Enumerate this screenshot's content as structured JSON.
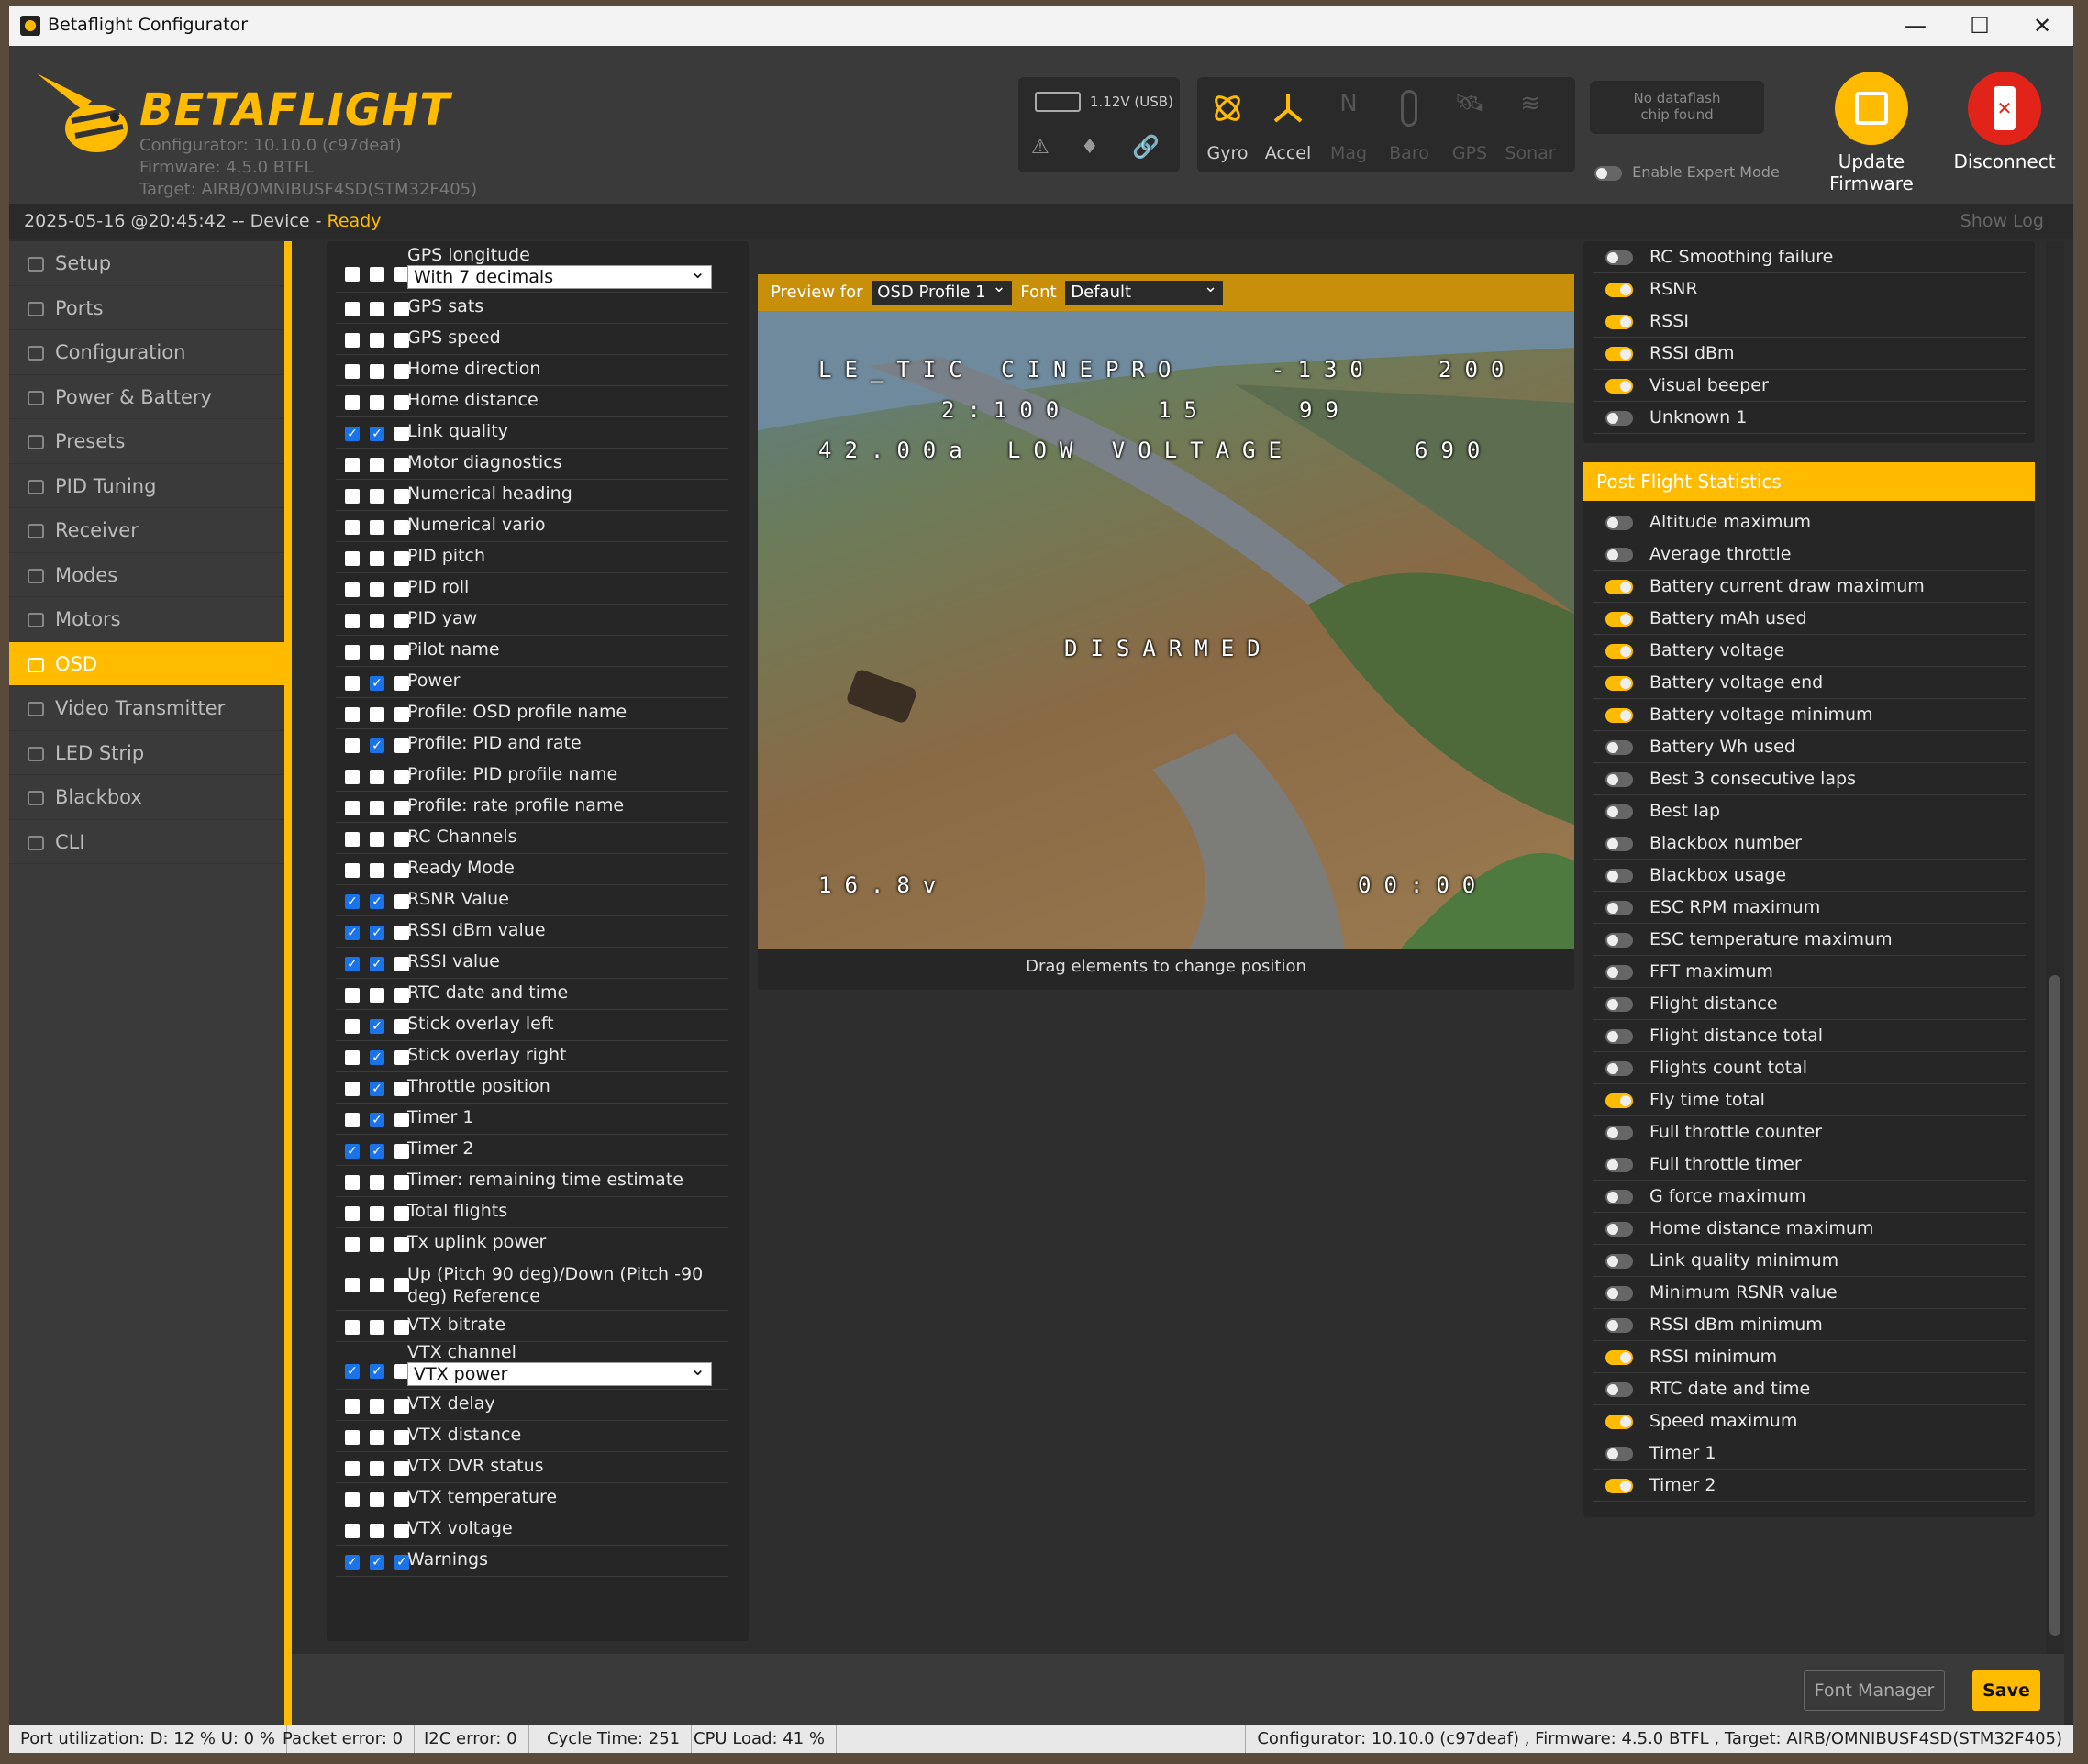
{
  "window": {
    "title": "Betaflight Configurator",
    "minimize": "—",
    "maximize": "☐",
    "close": "✕"
  },
  "header": {
    "brand": "BETAFLIGHT",
    "configurator": "Configurator: 10.10.0 (c97deaf)",
    "firmware": "Firmware: 4.5.0 BTFL",
    "target": "Target: AIRB/OMNIBUSF4SD(STM32F405)",
    "battery": "1.12V (USB)",
    "sensors": [
      "Gyro",
      "Accel",
      "Mag",
      "Baro",
      "GPS",
      "Sonar"
    ],
    "dataflash": [
      "No dataflash",
      "chip found"
    ],
    "expert_mode": "Enable Expert Mode",
    "update_firmware": [
      "Update",
      "Firmware"
    ],
    "disconnect": "Disconnect"
  },
  "status": {
    "datetime": "2025-05-16 @20:45:42",
    "sep": " -- Device - ",
    "state": "Ready",
    "show_log": "Show Log"
  },
  "sidebar": {
    "items": [
      "Setup",
      "Ports",
      "Configuration",
      "Power & Battery",
      "Presets",
      "PID Tuning",
      "Receiver",
      "Modes",
      "Motors",
      "OSD",
      "Video Transmitter",
      "LED Strip",
      "Blackbox",
      "CLI"
    ],
    "active": "OSD"
  },
  "elements": [
    {
      "label": "GPS longitude",
      "c": [
        0,
        0,
        0
      ],
      "select": "With 7 decimals"
    },
    {
      "label": "GPS sats",
      "c": [
        0,
        0,
        0
      ]
    },
    {
      "label": "GPS speed",
      "c": [
        0,
        0,
        0
      ]
    },
    {
      "label": "Home direction",
      "c": [
        0,
        0,
        0
      ]
    },
    {
      "label": "Home distance",
      "c": [
        0,
        0,
        0
      ]
    },
    {
      "label": "Link quality",
      "c": [
        1,
        1,
        0
      ]
    },
    {
      "label": "Motor diagnostics",
      "c": [
        0,
        0,
        0
      ]
    },
    {
      "label": "Numerical heading",
      "c": [
        0,
        0,
        0
      ]
    },
    {
      "label": "Numerical vario",
      "c": [
        0,
        0,
        0
      ]
    },
    {
      "label": "PID pitch",
      "c": [
        0,
        0,
        0
      ]
    },
    {
      "label": "PID roll",
      "c": [
        0,
        0,
        0
      ]
    },
    {
      "label": "PID yaw",
      "c": [
        0,
        0,
        0
      ]
    },
    {
      "label": "Pilot name",
      "c": [
        0,
        0,
        0
      ]
    },
    {
      "label": "Power",
      "c": [
        0,
        1,
        0
      ]
    },
    {
      "label": "Profile: OSD profile name",
      "c": [
        0,
        0,
        0
      ]
    },
    {
      "label": "Profile: PID and rate",
      "c": [
        0,
        1,
        0
      ]
    },
    {
      "label": "Profile: PID profile name",
      "c": [
        0,
        0,
        0
      ]
    },
    {
      "label": "Profile: rate profile name",
      "c": [
        0,
        0,
        0
      ]
    },
    {
      "label": "RC Channels",
      "c": [
        0,
        0,
        0
      ]
    },
    {
      "label": "Ready Mode",
      "c": [
        0,
        0,
        0
      ]
    },
    {
      "label": "RSNR Value",
      "c": [
        1,
        1,
        0
      ]
    },
    {
      "label": "RSSI dBm value",
      "c": [
        1,
        1,
        0
      ]
    },
    {
      "label": "RSSI value",
      "c": [
        1,
        1,
        0
      ]
    },
    {
      "label": "RTC date and time",
      "c": [
        0,
        0,
        0
      ]
    },
    {
      "label": "Stick overlay left",
      "c": [
        0,
        1,
        0
      ]
    },
    {
      "label": "Stick overlay right",
      "c": [
        0,
        1,
        0
      ]
    },
    {
      "label": "Throttle position",
      "c": [
        0,
        1,
        0
      ]
    },
    {
      "label": "Timer 1",
      "c": [
        0,
        1,
        0
      ]
    },
    {
      "label": "Timer 2",
      "c": [
        1,
        1,
        0
      ]
    },
    {
      "label": "Timer: remaining time estimate",
      "c": [
        0,
        0,
        0
      ]
    },
    {
      "label": "Total flights",
      "c": [
        0,
        0,
        0
      ]
    },
    {
      "label": "Tx uplink power",
      "c": [
        0,
        0,
        0
      ]
    },
    {
      "label": "Up (Pitch 90 deg)/Down (Pitch -90 deg) Reference",
      "c": [
        0,
        0,
        0
      ],
      "tall": true
    },
    {
      "label": "VTX bitrate",
      "c": [
        0,
        0,
        0
      ]
    },
    {
      "label": "VTX channel",
      "c": [
        1,
        1,
        0
      ],
      "select": "VTX power"
    },
    {
      "label": "VTX delay",
      "c": [
        0,
        0,
        0
      ]
    },
    {
      "label": "VTX distance",
      "c": [
        0,
        0,
        0
      ]
    },
    {
      "label": "VTX DVR status",
      "c": [
        0,
        0,
        0
      ]
    },
    {
      "label": "VTX temperature",
      "c": [
        0,
        0,
        0
      ]
    },
    {
      "label": "VTX voltage",
      "c": [
        0,
        0,
        0
      ]
    },
    {
      "label": "Warnings",
      "c": [
        1,
        1,
        1
      ]
    }
  ],
  "preview": {
    "preview_for": "Preview for",
    "profile": "OSD Profile 1",
    "font_label": "Font",
    "font": "Default",
    "caption": "Drag elements to change position",
    "osd": {
      "craft": "LE_TIC CINEPRO",
      "rssi_dbm": "-130",
      "rsnr_val": "200",
      "profile": "2:100",
      "rsnr": "15",
      "lq": "99",
      "current": "42.00a",
      "warning": "LOW VOLTAGE",
      "mah": "690",
      "disarmed": "DISARMED",
      "voltage": "16.8v",
      "timer": "00:00"
    }
  },
  "warnings_list": [
    {
      "label": "RC Smoothing failure",
      "on": false
    },
    {
      "label": "RSNR",
      "on": true
    },
    {
      "label": "RSSI",
      "on": true
    },
    {
      "label": "RSSI dBm",
      "on": true
    },
    {
      "label": "Visual beeper",
      "on": true
    },
    {
      "label": "Unknown 1",
      "on": false
    }
  ],
  "post_flight": {
    "title": "Post Flight Statistics",
    "items": [
      {
        "label": "Altitude maximum",
        "on": false
      },
      {
        "label": "Average throttle",
        "on": false
      },
      {
        "label": "Battery current draw maximum",
        "on": true
      },
      {
        "label": "Battery mAh used",
        "on": true
      },
      {
        "label": "Battery voltage",
        "on": true
      },
      {
        "label": "Battery voltage end",
        "on": true
      },
      {
        "label": "Battery voltage minimum",
        "on": true
      },
      {
        "label": "Battery Wh used",
        "on": false
      },
      {
        "label": "Best 3 consecutive laps",
        "on": false
      },
      {
        "label": "Best lap",
        "on": false
      },
      {
        "label": "Blackbox number",
        "on": false
      },
      {
        "label": "Blackbox usage",
        "on": false
      },
      {
        "label": "ESC RPM maximum",
        "on": false
      },
      {
        "label": "ESC temperature maximum",
        "on": false
      },
      {
        "label": "FFT maximum",
        "on": false
      },
      {
        "label": "Flight distance",
        "on": false
      },
      {
        "label": "Flight distance total",
        "on": false
      },
      {
        "label": "Flights count total",
        "on": false
      },
      {
        "label": "Fly time total",
        "on": true
      },
      {
        "label": "Full throttle counter",
        "on": false
      },
      {
        "label": "Full throttle timer",
        "on": false
      },
      {
        "label": "G force maximum",
        "on": false
      },
      {
        "label": "Home distance maximum",
        "on": false
      },
      {
        "label": "Link quality minimum",
        "on": false
      },
      {
        "label": "Minimum RSNR value",
        "on": false
      },
      {
        "label": "RSSI dBm minimum",
        "on": false
      },
      {
        "label": "RSSI minimum",
        "on": true
      },
      {
        "label": "RTC date and time",
        "on": false
      },
      {
        "label": "Speed maximum",
        "on": true
      },
      {
        "label": "Timer 1",
        "on": false
      },
      {
        "label": "Timer 2",
        "on": true
      }
    ]
  },
  "footer": {
    "font_manager": "Font Manager",
    "save": "Save"
  },
  "bottom": {
    "port": "Port utilization: D: 12 % U: 0 %",
    "packet": "Packet error: 0",
    "i2c": "I2C error: 0",
    "cycle": "Cycle Time: 251",
    "cpu": "CPU Load: 41 %",
    "version": "Configurator: 10.10.0 (c97deaf) , Firmware: 4.5.0 BTFL , Target: AIRB/OMNIBUSF4SD(STM32F405)"
  },
  "colors": {
    "accent": "#ffbb00",
    "checked": "#1a73e8",
    "danger": "#e2231a"
  }
}
